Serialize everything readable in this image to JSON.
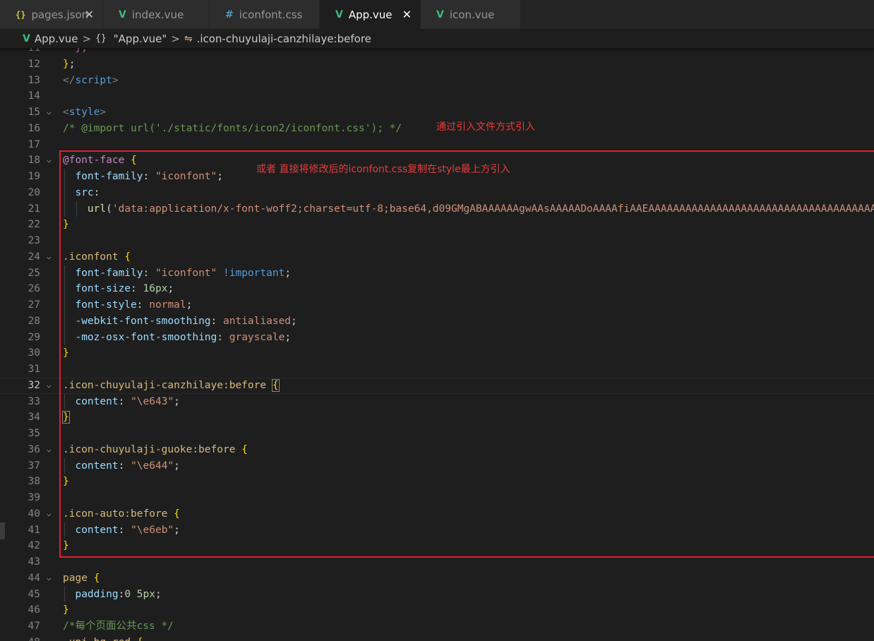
{
  "tabs": [
    {
      "icon": "{}",
      "icon_name": "json-file-icon",
      "label": "pages.json",
      "closable": true,
      "active": false
    },
    {
      "icon": "V",
      "icon_name": "vue-file-icon",
      "label": "index.vue",
      "closable": false,
      "active": false
    },
    {
      "icon": "#",
      "icon_name": "css-file-icon",
      "label": "iconfont.css",
      "closable": false,
      "active": false
    },
    {
      "icon": "V",
      "icon_name": "vue-file-icon",
      "label": "App.vue",
      "closable": true,
      "active": true
    },
    {
      "icon": "V",
      "icon_name": "vue-file-icon",
      "label": "icon.vue",
      "closable": false,
      "active": false
    }
  ],
  "breadcrumb": {
    "file": "App.vue",
    "object": "\"App.vue\"",
    "selector": ".icon-chuyulaji-canzhilaye:before",
    "separator": ">",
    "object_icon": "{}",
    "selector_icon": "⇋"
  },
  "annotations": {
    "import_note": "通过引入文件方式引入",
    "copy_note": "或者  直接将修改后的iconfont.css复制在style最上方引入"
  },
  "colors": {
    "background": "#1e1e1e",
    "tab_bar": "#252526",
    "annotation": "#e83b3b",
    "box": "#e0202e"
  },
  "current_line": 32,
  "lines": [
    {
      "n": "11",
      "tokens": [
        {
          "c": "t-brc2",
          "t": "  },"
        }
      ]
    },
    {
      "n": "12",
      "tokens": [
        {
          "c": "t-brc",
          "t": "}"
        },
        {
          "c": "t-pun",
          "t": ";"
        }
      ]
    },
    {
      "n": "13",
      "tokens": [
        {
          "c": "t-tag",
          "t": "</"
        },
        {
          "c": "t-tn",
          "t": "script"
        },
        {
          "c": "t-tag",
          "t": ">"
        }
      ]
    },
    {
      "n": "14",
      "tokens": []
    },
    {
      "n": "15",
      "fold": true,
      "tokens": [
        {
          "c": "t-tag",
          "t": "<"
        },
        {
          "c": "t-tn",
          "t": "style"
        },
        {
          "c": "t-tag",
          "t": ">"
        }
      ]
    },
    {
      "n": "16",
      "tokens": [
        {
          "c": "t-com",
          "t": "/* @import url('./static/fonts/icon2/iconfont.css'); */"
        }
      ]
    },
    {
      "n": "17",
      "tokens": []
    },
    {
      "n": "18",
      "fold": true,
      "tokens": [
        {
          "c": "t-at",
          "t": "@font-face"
        },
        {
          "c": "t-pun",
          "t": " "
        },
        {
          "c": "t-brc",
          "t": "{"
        }
      ]
    },
    {
      "n": "19",
      "tokens": [
        {
          "c": "t-pun",
          "t": "  "
        },
        {
          "c": "t-prop",
          "t": "font-family"
        },
        {
          "c": "t-pun",
          "t": ": "
        },
        {
          "c": "t-str",
          "t": "\"iconfont\""
        },
        {
          "c": "t-pun",
          "t": ";"
        }
      ]
    },
    {
      "n": "20",
      "tokens": [
        {
          "c": "t-pun",
          "t": "  "
        },
        {
          "c": "t-prop",
          "t": "src"
        },
        {
          "c": "t-pun",
          "t": ":"
        }
      ]
    },
    {
      "n": "21",
      "tokens": [
        {
          "c": "t-pun",
          "t": "    "
        },
        {
          "c": "t-fn",
          "t": "url"
        },
        {
          "c": "t-pun",
          "t": "("
        },
        {
          "c": "t-str",
          "t": "'data:application/x-font-woff2;charset=utf-8;base64,d09GMgABAAAAAAgwAAsAAAAADoAAAAfiAAEAAAAAAAAAAAAAAAAAAAAAAAAAAAAAAAAAAAAAAAAAAAAAAAAAAAA"
        }
      ]
    },
    {
      "n": "22",
      "tokens": [
        {
          "c": "t-brc",
          "t": "}"
        }
      ]
    },
    {
      "n": "23",
      "tokens": []
    },
    {
      "n": "24",
      "fold": true,
      "tokens": [
        {
          "c": "t-sel",
          "t": ".iconfont"
        },
        {
          "c": "t-pun",
          "t": " "
        },
        {
          "c": "t-brc",
          "t": "{"
        }
      ]
    },
    {
      "n": "25",
      "tokens": [
        {
          "c": "t-pun",
          "t": "  "
        },
        {
          "c": "t-prop",
          "t": "font-family"
        },
        {
          "c": "t-pun",
          "t": ": "
        },
        {
          "c": "t-str",
          "t": "\"iconfont\""
        },
        {
          "c": "t-pun",
          "t": " "
        },
        {
          "c": "t-kw",
          "t": "!important"
        },
        {
          "c": "t-pun",
          "t": ";"
        }
      ]
    },
    {
      "n": "26",
      "tokens": [
        {
          "c": "t-pun",
          "t": "  "
        },
        {
          "c": "t-prop",
          "t": "font-size"
        },
        {
          "c": "t-pun",
          "t": ": "
        },
        {
          "c": "t-num",
          "t": "16px"
        },
        {
          "c": "t-pun",
          "t": ";"
        }
      ]
    },
    {
      "n": "27",
      "tokens": [
        {
          "c": "t-pun",
          "t": "  "
        },
        {
          "c": "t-prop",
          "t": "font-style"
        },
        {
          "c": "t-pun",
          "t": ": "
        },
        {
          "c": "t-val",
          "t": "normal"
        },
        {
          "c": "t-pun",
          "t": ";"
        }
      ]
    },
    {
      "n": "28",
      "tokens": [
        {
          "c": "t-pun",
          "t": "  "
        },
        {
          "c": "t-prop",
          "t": "-webkit-font-smoothing"
        },
        {
          "c": "t-pun",
          "t": ": "
        },
        {
          "c": "t-val",
          "t": "antialiased"
        },
        {
          "c": "t-pun",
          "t": ";"
        }
      ]
    },
    {
      "n": "29",
      "tokens": [
        {
          "c": "t-pun",
          "t": "  "
        },
        {
          "c": "t-prop",
          "t": "-moz-osx-font-smoothing"
        },
        {
          "c": "t-pun",
          "t": ": "
        },
        {
          "c": "t-val",
          "t": "grayscale"
        },
        {
          "c": "t-pun",
          "t": ";"
        }
      ]
    },
    {
      "n": "30",
      "tokens": [
        {
          "c": "t-brc",
          "t": "}"
        }
      ]
    },
    {
      "n": "31",
      "tokens": []
    },
    {
      "n": "32",
      "fold": true,
      "tokens": [
        {
          "c": "t-sel",
          "t": ".icon-chuyulaji-canzhilaye:before"
        },
        {
          "c": "t-pun",
          "t": " "
        },
        {
          "c": "t-brc t-bmatch",
          "t": "{"
        }
      ]
    },
    {
      "n": "33",
      "tokens": [
        {
          "c": "t-pun",
          "t": "  "
        },
        {
          "c": "t-prop",
          "t": "content"
        },
        {
          "c": "t-pun",
          "t": ": "
        },
        {
          "c": "t-str",
          "t": "\"\\e643\""
        },
        {
          "c": "t-pun",
          "t": ";"
        }
      ]
    },
    {
      "n": "34",
      "tokens": [
        {
          "c": "t-brc t-bmatch",
          "t": "}"
        }
      ]
    },
    {
      "n": "35",
      "tokens": []
    },
    {
      "n": "36",
      "fold": true,
      "tokens": [
        {
          "c": "t-sel",
          "t": ".icon-chuyulaji-guoke:before"
        },
        {
          "c": "t-pun",
          "t": " "
        },
        {
          "c": "t-brc",
          "t": "{"
        }
      ]
    },
    {
      "n": "37",
      "tokens": [
        {
          "c": "t-pun",
          "t": "  "
        },
        {
          "c": "t-prop",
          "t": "content"
        },
        {
          "c": "t-pun",
          "t": ": "
        },
        {
          "c": "t-str",
          "t": "\"\\e644\""
        },
        {
          "c": "t-pun",
          "t": ";"
        }
      ]
    },
    {
      "n": "38",
      "tokens": [
        {
          "c": "t-brc",
          "t": "}"
        }
      ]
    },
    {
      "n": "39",
      "tokens": []
    },
    {
      "n": "40",
      "fold": true,
      "tokens": [
        {
          "c": "t-sel",
          "t": ".icon-auto:before"
        },
        {
          "c": "t-pun",
          "t": " "
        },
        {
          "c": "t-brc",
          "t": "{"
        }
      ]
    },
    {
      "n": "41",
      "tokens": [
        {
          "c": "t-pun",
          "t": "  "
        },
        {
          "c": "t-prop",
          "t": "content"
        },
        {
          "c": "t-pun",
          "t": ": "
        },
        {
          "c": "t-str",
          "t": "\"\\e6eb\""
        },
        {
          "c": "t-pun",
          "t": ";"
        }
      ]
    },
    {
      "n": "42",
      "tokens": [
        {
          "c": "t-brc",
          "t": "}"
        }
      ]
    },
    {
      "n": "43",
      "tokens": []
    },
    {
      "n": "44",
      "fold": true,
      "tokens": [
        {
          "c": "t-sel",
          "t": "page"
        },
        {
          "c": "t-pun",
          "t": " "
        },
        {
          "c": "t-brc",
          "t": "{"
        }
      ]
    },
    {
      "n": "45",
      "tokens": [
        {
          "c": "t-pun",
          "t": "  "
        },
        {
          "c": "t-prop",
          "t": "padding"
        },
        {
          "c": "t-pun",
          "t": ":"
        },
        {
          "c": "t-num",
          "t": "0 5px"
        },
        {
          "c": "t-pun",
          "t": ";"
        }
      ]
    },
    {
      "n": "46",
      "tokens": [
        {
          "c": "t-brc",
          "t": "}"
        }
      ]
    },
    {
      "n": "47",
      "tokens": [
        {
          "c": "t-com",
          "t": "/*每个页面公共css */"
        }
      ]
    },
    {
      "n": "48",
      "fold": true,
      "tokens": [
        {
          "c": "t-sel",
          "t": ".uni-bg-red"
        },
        {
          "c": "t-pun",
          "t": " "
        },
        {
          "c": "t-brc",
          "t": "{"
        }
      ]
    }
  ]
}
